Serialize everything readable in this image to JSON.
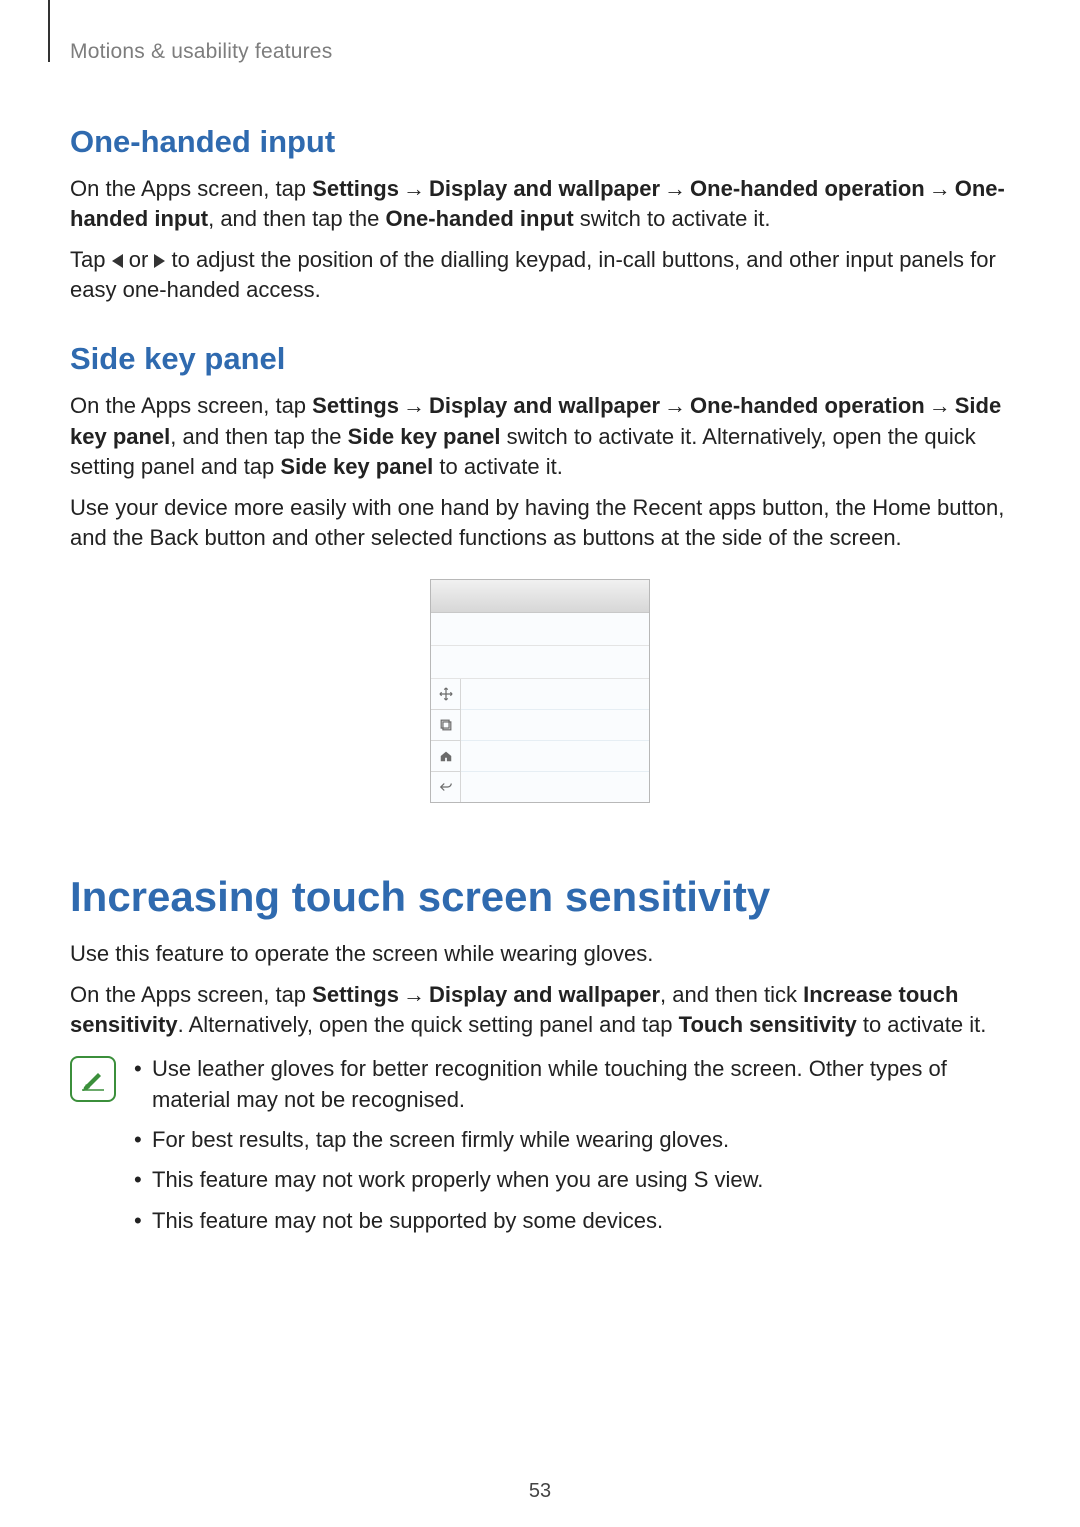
{
  "header": {
    "breadcrumb": "Motions & usability features"
  },
  "sections": {
    "one_handed": {
      "title": "One-handed input",
      "para1": {
        "pre": "On the Apps screen, tap ",
        "b1": "Settings",
        "b2": "Display and wallpaper",
        "b3": "One-handed operation",
        "b4": "One-handed input",
        "mid1": ", and then tap the ",
        "b5": "One-handed input",
        "post": " switch to activate it."
      },
      "para2": {
        "pre": "Tap ",
        "mid": " or ",
        "post": " to adjust the position of the dialling keypad, in-call buttons, and other input panels for easy one-handed access."
      }
    },
    "side_key": {
      "title": "Side key panel",
      "para1": {
        "pre": "On the Apps screen, tap ",
        "b1": "Settings",
        "b2": "Display and wallpaper",
        "b3": "One-handed operation",
        "b4": "Side key panel",
        "mid1": ", and then tap the ",
        "b5": "Side key panel",
        "mid2": " switch to activate it. Alternatively, open the quick setting panel and tap ",
        "b6": "Side key panel",
        "post": " to activate it."
      },
      "para2": "Use your device more easily with one hand by having the Recent apps button, the Home button, and the Back button and other selected functions as buttons at the side of the screen."
    },
    "sensitivity": {
      "title": "Increasing touch screen sensitivity",
      "para1": "Use this feature to operate the screen while wearing gloves.",
      "para2": {
        "pre": "On the Apps screen, tap ",
        "b1": "Settings",
        "b2": "Display and wallpaper",
        "mid1": ", and then tick ",
        "b3": "Increase touch sensitivity",
        "mid2": ". Alternatively, open the quick setting panel and tap ",
        "b4": "Touch sensitivity",
        "post": " to activate it."
      },
      "notes": [
        "Use leather gloves for better recognition while touching the screen. Other types of material may not be recognised.",
        "For best results, tap the screen firmly while wearing gloves.",
        "This feature may not work properly when you are using S view.",
        "This feature may not be supported by some devices."
      ]
    }
  },
  "arrow_glyph": "→",
  "page_number": "53"
}
